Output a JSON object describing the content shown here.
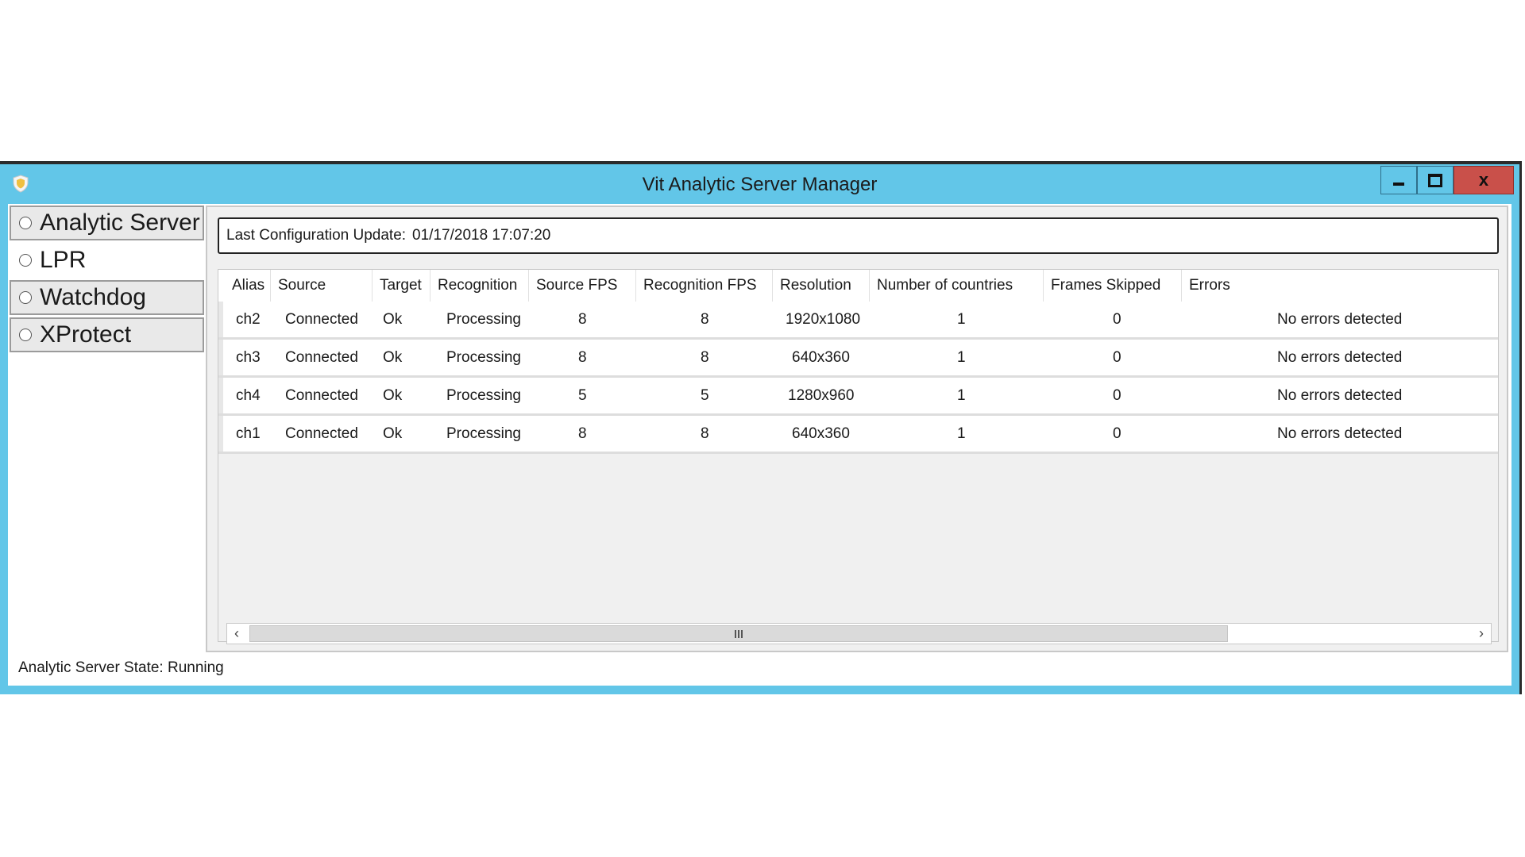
{
  "window": {
    "title": "Vit Analytic Server Manager",
    "close_label": "x"
  },
  "nav": {
    "items": [
      {
        "label": "Analytic Server"
      },
      {
        "label": "LPR"
      },
      {
        "label": "Watchdog"
      },
      {
        "label": "XProtect"
      }
    ]
  },
  "config": {
    "label": "Last Configuration Update:",
    "value": "01/17/2018 17:07:20"
  },
  "table": {
    "columns": [
      "Alias",
      "Source",
      "Target",
      "Recognition",
      "Source FPS",
      "Recognition FPS",
      "Resolution",
      "Number of countries",
      "Frames Skipped",
      "Errors"
    ],
    "rows": [
      [
        "ch2",
        "Connected",
        "Ok",
        "Processing",
        "8",
        "8",
        "1920x1080",
        "1",
        "0",
        "No errors detected"
      ],
      [
        "ch3",
        "Connected",
        "Ok",
        "Processing",
        "8",
        "8",
        "640x360",
        "1",
        "0",
        "No errors detected"
      ],
      [
        "ch4",
        "Connected",
        "Ok",
        "Processing",
        "5",
        "5",
        "1280x960",
        "1",
        "0",
        "No errors detected"
      ],
      [
        "ch1",
        "Connected",
        "Ok",
        "Processing",
        "8",
        "8",
        "640x360",
        "1",
        "0",
        "No errors detected"
      ]
    ]
  },
  "scroll": {
    "left_arrow": "‹",
    "right_arrow": "›"
  },
  "status": {
    "text": "Analytic Server State: Running"
  },
  "colors": {
    "frame": "#62c6e8",
    "close": "#c9504a"
  },
  "icons": {
    "app": "shield-icon"
  }
}
